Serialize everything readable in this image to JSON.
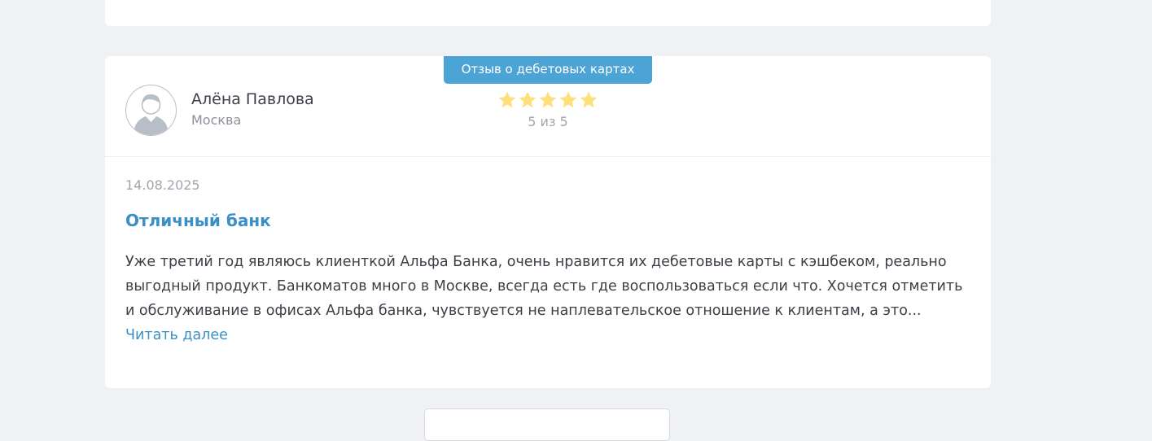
{
  "review": {
    "category_badge": "Отзыв о дебетовых картах",
    "author": {
      "name": "Алёна Павлова",
      "city": "Москва",
      "avatar_icon": "user-placeholder-icon"
    },
    "rating": {
      "value": 5,
      "max": 5,
      "text": "5 из 5",
      "star_color": "#fde07a"
    },
    "date": "14.08.2025",
    "title": "Отличный банк",
    "text": "Уже третий год являюсь клиенткой Альфа Банка, очень нравится их дебетовые карты с кэшбеком, реально выгодный продукт. Банкоматов много в Москве, всегда есть где воспользоваться если что. Хочется отметить и обслуживание в офисах Альфа банка, чувствуется не наплевательское отношение к клиентам, а это...",
    "read_more": "Читать далее"
  },
  "colors": {
    "page_background": "#eff1f5",
    "card_background": "#ffffff",
    "accent": "#4ba3d6",
    "link": "#3a8fc6"
  }
}
